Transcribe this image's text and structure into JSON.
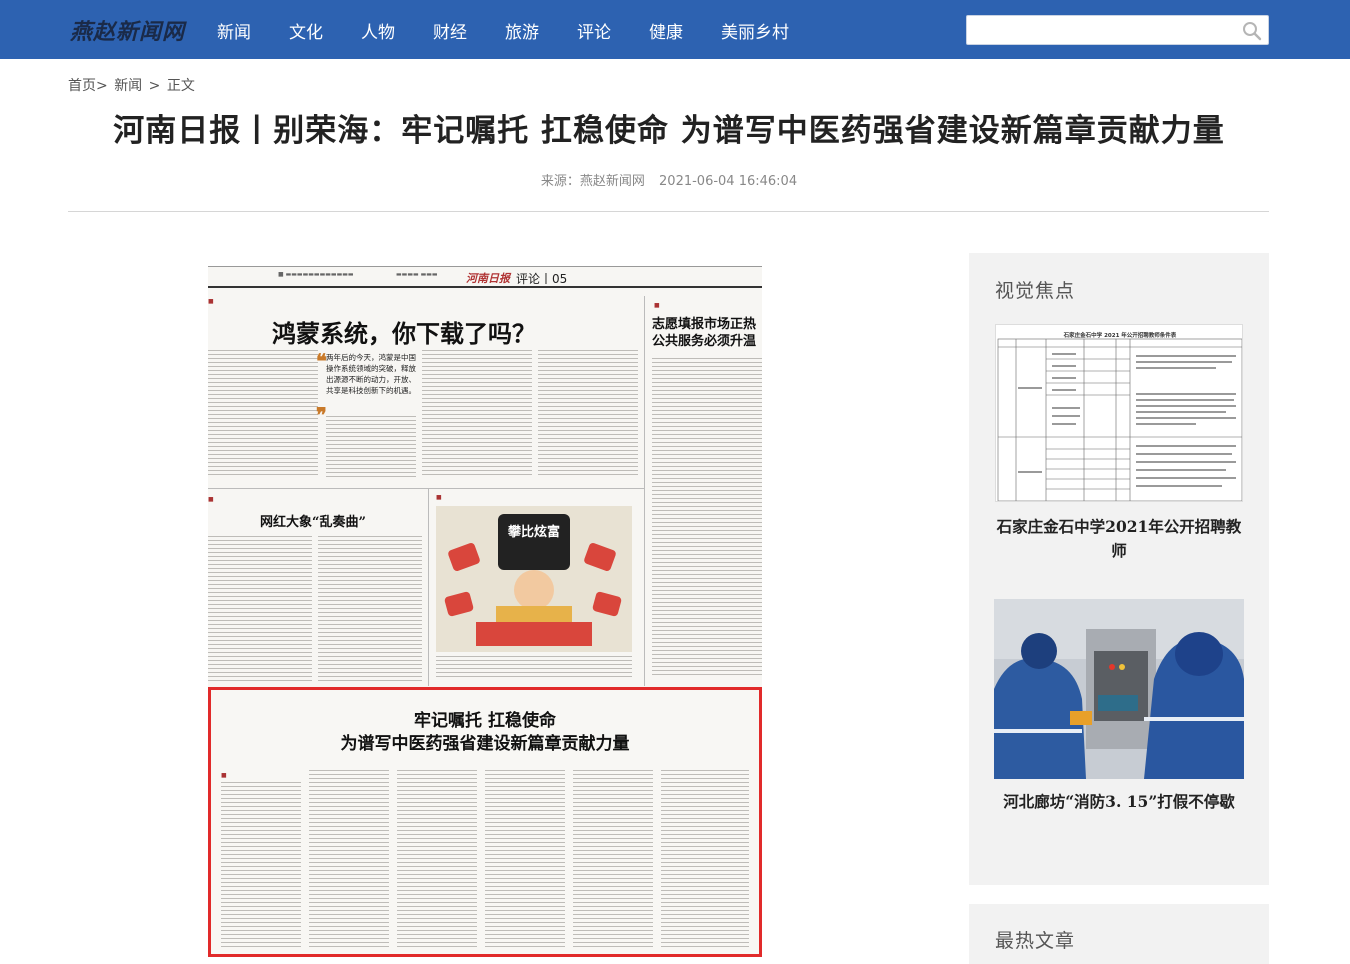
{
  "site": {
    "logo_text": "燕赵新闻网"
  },
  "nav": {
    "items": [
      "新闻",
      "文化",
      "人物",
      "财经",
      "旅游",
      "评论",
      "健康",
      "美丽乡村"
    ]
  },
  "search": {
    "placeholder": ""
  },
  "breadcrumb": {
    "home": "首页>",
    "news": "新闻",
    "sep": ">",
    "current": "正文"
  },
  "article": {
    "title": "河南日报丨别荣海：牢记嘱托 扛稳使命 为谱写中医药强省建设新篇章贡献力量",
    "source": "来源：燕赵新闻网",
    "datetime": "2021-06-04 16:46:04"
  },
  "newspaper": {
    "brand": "河南日报",
    "section": "评论丨05",
    "headline": "鸿蒙系统，你下载了吗？",
    "side_headline": "志愿填报市场正热 公共服务必须升温",
    "sub_headline": "网红大象“乱奏曲”",
    "main_headline_1": "牢记嘱托 扛稳使命",
    "main_headline_2": "为谱写中医药强省建设新篇章贡献力量",
    "quote": "两年后的今天，鸿蒙是中国操作系统领域的突破，释放出源源不断的动力，开放、共享是科技创新下的机遇。",
    "cartoon_text": "攀比炫富"
  },
  "sidebar": {
    "visual_heading": "视觉焦点",
    "item1_title": "石家庄金石中学2021年公开招聘教师",
    "item1_table_title": "石家庄金石中学 2021 年公开招聘教师条件表",
    "item2_title": "河北廊坊“消防3. 15”打假不停歇",
    "hot_heading": "最热文章"
  }
}
